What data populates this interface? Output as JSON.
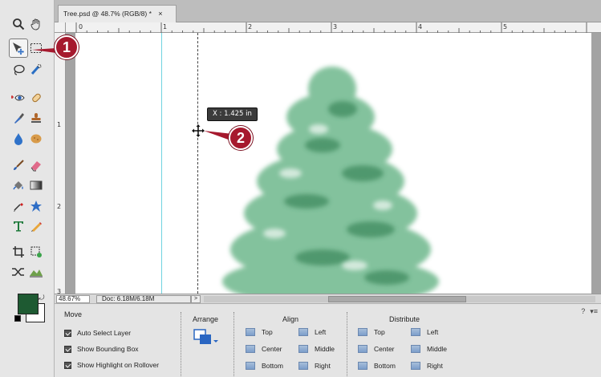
{
  "document": {
    "tab_title": "Tree.psd @ 48.7% (RGB/8)",
    "tab_modified": "*",
    "tab_close": "×"
  },
  "rulers": {
    "horizontal": [
      "0",
      "1",
      "2",
      "3",
      "4",
      "5"
    ],
    "vertical": [
      "1",
      "2",
      "3"
    ]
  },
  "tooltip": "X : 1.425 in",
  "callouts": [
    "1",
    "2"
  ],
  "status": {
    "zoom": "48.67%",
    "doc_size": "Doc: 6.18M/6.18M",
    "arrow": ">"
  },
  "colors": {
    "foreground": "#1e5a32",
    "background": "#ffffff",
    "callout": "#a6192e",
    "guide": "#6fd3e0"
  },
  "tools": [
    "zoom-tool",
    "hand-tool",
    "move-tool",
    "marquee-tool",
    "lasso-tool",
    "quick-selection-tool",
    "red-eye-tool",
    "spot-healing-tool",
    "smart-brush-tool",
    "clone-stamp-tool",
    "blur-tool",
    "sponge-tool",
    "brush-tool",
    "eraser-tool",
    "paint-bucket-tool",
    "gradient-tool",
    "eyedropper-tool",
    "custom-shape-tool",
    "type-tool",
    "pencil-tool",
    "crop-tool",
    "recompose-tool",
    "content-aware-move-tool",
    "straighten-tool"
  ],
  "options": {
    "move_title": "Move",
    "auto_select": "Auto Select Layer",
    "bounding_box": "Show Bounding Box",
    "highlight": "Show Highlight on Rollover",
    "arrange_title": "Arrange",
    "align_title": "Align",
    "distribute_title": "Distribute",
    "align": {
      "top": "Top",
      "center": "Center",
      "bottom": "Bottom",
      "left": "Left",
      "middle": "Middle",
      "right": "Right"
    },
    "distribute": {
      "top": "Top",
      "center": "Center",
      "bottom": "Bottom",
      "left": "Left",
      "middle": "Middle",
      "right": "Right"
    },
    "panel_menu": "▾≡",
    "help": "?"
  }
}
